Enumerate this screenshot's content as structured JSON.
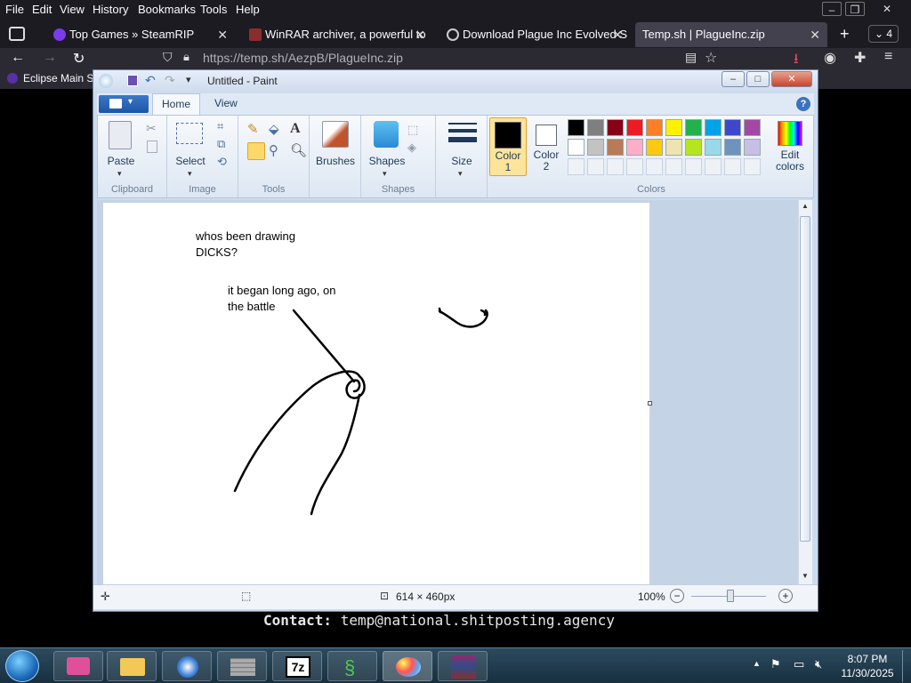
{
  "browser": {
    "menu": [
      "File",
      "Edit",
      "View",
      "History",
      "Bookmarks",
      "Tools",
      "Help"
    ],
    "tabs": [
      {
        "label": "Top Games » SteamRIP",
        "icon_color": "#7c3aed"
      },
      {
        "label": "WinRAR archiver, a powerful to",
        "icon_color": "#8b2d2d"
      },
      {
        "label": "Download Plague Inc Evolved S",
        "icon_color": "#cccccc"
      },
      {
        "label": "Temp.sh | PlagueInc.zip",
        "icon_color": "#42414d"
      }
    ],
    "tab_count": "4",
    "url": "https://temp.sh/AezpB/PlagueInc.zip",
    "bookmark": "Eclipse Main S",
    "page_contact_label": "Contact:",
    "page_contact_value": "temp@national.shitposting.agency"
  },
  "paint": {
    "window_title": "Untitled - Paint",
    "ribbon_tabs": [
      "Home",
      "View"
    ],
    "groups": {
      "clipboard": {
        "label": "Clipboard",
        "paste": "Paste"
      },
      "image": {
        "label": "Image",
        "select": "Select"
      },
      "tools": {
        "label": "Tools"
      },
      "brushes": {
        "label": "Brushes"
      },
      "shapes": {
        "label": "Shapes",
        "shapes_btn": "Shapes"
      },
      "size": {
        "label": "Size"
      },
      "colors": {
        "label": "Colors",
        "color1": "Color\n1",
        "color2": "Color\n2",
        "edit_colors": "Edit\ncolors",
        "color1_value": "#000000",
        "color2_value": "#ffffff",
        "palette_row1": [
          "#000000",
          "#7f7f7f",
          "#880015",
          "#ed1c24",
          "#ff7f27",
          "#fff200",
          "#22b14c",
          "#00a2e8",
          "#3f48cc",
          "#a349a4"
        ],
        "palette_row2": [
          "#ffffff",
          "#c3c3c3",
          "#b97a57",
          "#ffaec9",
          "#ffc90e",
          "#efe4b0",
          "#b5e61d",
          "#99d9ea",
          "#7092be",
          "#c8bfe7"
        ]
      }
    },
    "canvas_text": {
      "note1": "whos been drawing\nDICKS?",
      "note2": "it began long ago, on\nthe battle"
    },
    "status": {
      "dimensions": "614 × 460px",
      "zoom": "100%"
    }
  },
  "taskbar": {
    "time": "8:07 PM",
    "date": "11/30/2025",
    "apps": [
      "app-pink",
      "explorer",
      "browser",
      "firewall",
      "7-zip",
      "snake",
      "paint",
      "winrar"
    ]
  }
}
